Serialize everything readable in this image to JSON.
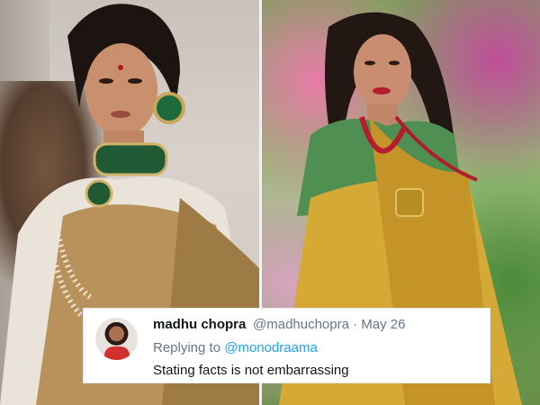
{
  "tweet": {
    "name": "madhu chopra",
    "handle_date": "@madhuchopra · May 26",
    "replying_prefix": "Replying to ",
    "replying_mention": "@monodraama",
    "text": "Stating facts is not embarrassing"
  },
  "colors": {
    "name_text": "#14171a",
    "secondary_text": "#657786",
    "mention": "#1da1f2",
    "left_saree_gold": "#b8925a",
    "right_saree_gold": "#d4a936",
    "right_blouse_green": "#4f8f52"
  },
  "images": {
    "left_photo": "woman-in-gold-saree-with-emerald-jewelry",
    "right_photo": "woman-in-gold-saree-with-green-blouse",
    "avatar": "profile-avatar"
  }
}
